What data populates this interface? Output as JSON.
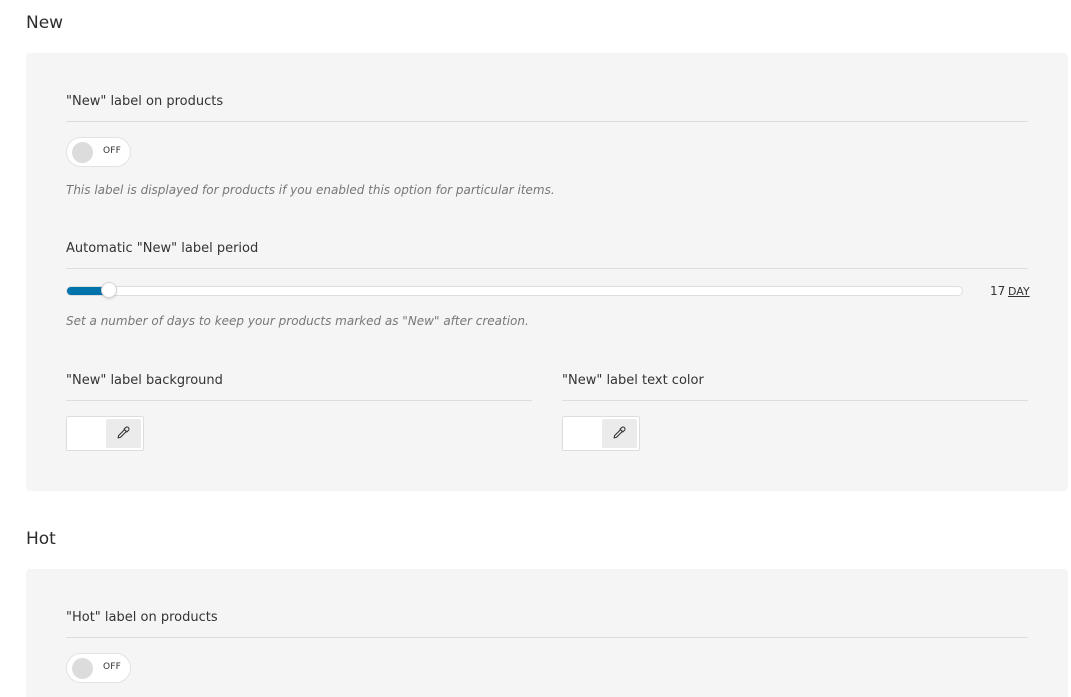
{
  "sections": [
    {
      "title": "New",
      "label_option": {
        "title": "\"New\" label on products",
        "toggle_state": "OFF",
        "description": "This label is displayed for products if you enabled this option for particular items."
      },
      "period_option": {
        "title": "Automatic \"New\" label period",
        "value": "17",
        "value_numeric": 17,
        "unit": "DAY",
        "description": "Set a number of days to keep your products marked as \"New\" after creation."
      },
      "background_option": {
        "title": "\"New\" label background",
        "color": "#ffffff",
        "picker_icon": "eyedropper-icon"
      },
      "text_color_option": {
        "title": "\"New\" label text color",
        "color": "#ffffff",
        "picker_icon": "eyedropper-icon"
      }
    },
    {
      "title": "Hot",
      "label_option": {
        "title": "\"Hot\" label on products",
        "toggle_state": "OFF"
      }
    }
  ],
  "colors": {
    "accent": "#0073aa",
    "panel_bg": "#f5f5f5",
    "divider": "#dddddd"
  }
}
